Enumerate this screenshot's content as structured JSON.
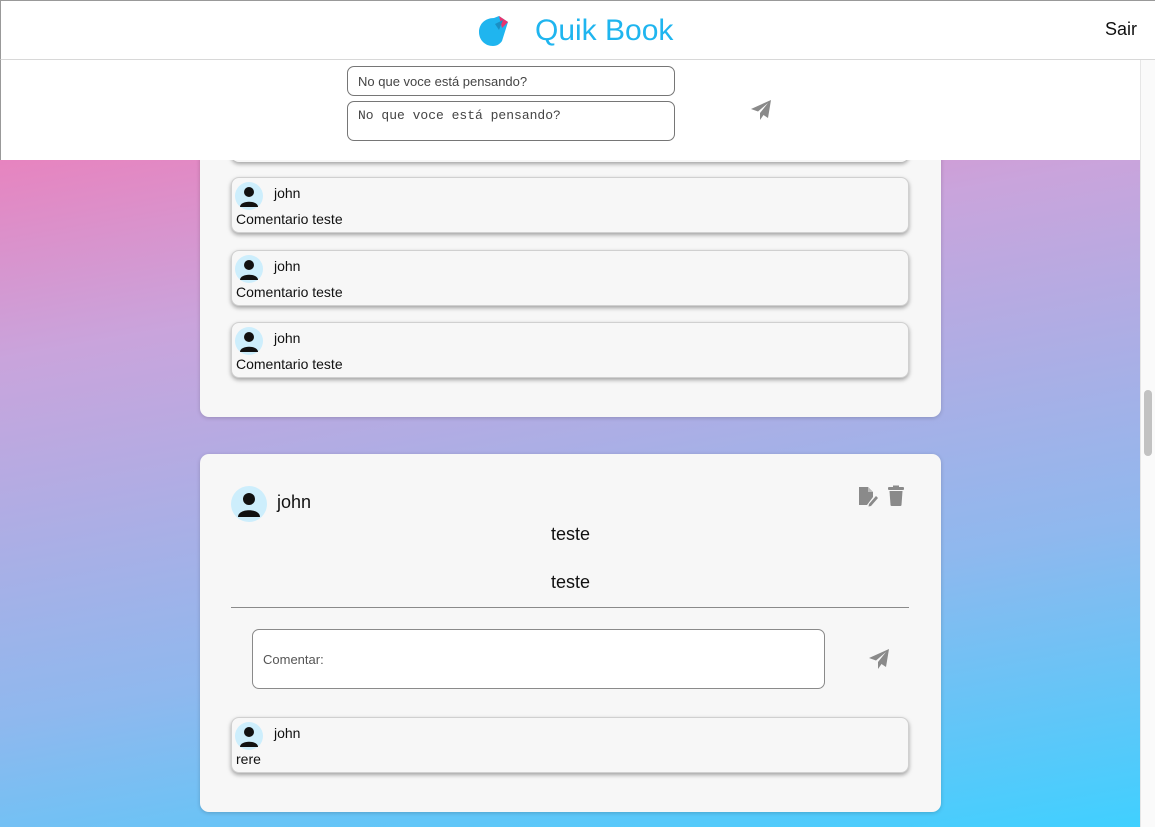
{
  "header": {
    "brand_name": "Quik Book",
    "logout_label": "Sair",
    "brand_colors": {
      "primary": "#1fb5ef",
      "accent": "#e8346e"
    }
  },
  "composer": {
    "title_placeholder": "No que voce está pensando?",
    "body_placeholder": "No que voce está pensando?",
    "send_icon": "paper-plane-icon"
  },
  "top_post": {
    "comments": [
      {
        "author": "john",
        "text": "Comentario teste"
      },
      {
        "author": "john",
        "text": "Comentario teste"
      },
      {
        "author": "john",
        "text": "Comentario teste"
      }
    ]
  },
  "post": {
    "author": "john",
    "title": "teste",
    "body": "teste",
    "edit_icon": "edit-document-icon",
    "delete_icon": "trash-icon",
    "comment_placeholder": "Comentar:",
    "comments": [
      {
        "author": "john",
        "text": "rere"
      }
    ]
  }
}
